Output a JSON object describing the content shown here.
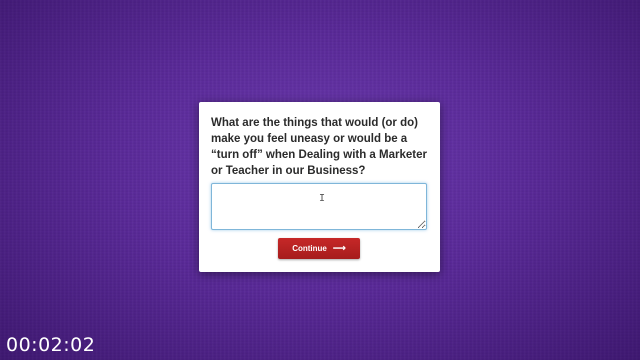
{
  "survey": {
    "question": "What are the things that would (or do) make you feel uneasy or would be a “turn off” when Dealing with a Marketer or Teacher in our Business?",
    "answer_value": "",
    "continue_label": "Continue",
    "continue_icon": "right-arrow-icon"
  },
  "overlay": {
    "timer": "00:02:02"
  },
  "colors": {
    "background": "#5a2a9a",
    "card": "#ffffff",
    "button": "#b52222",
    "input_focus_border": "#7fb6d9",
    "text": "#2b2b2b"
  }
}
